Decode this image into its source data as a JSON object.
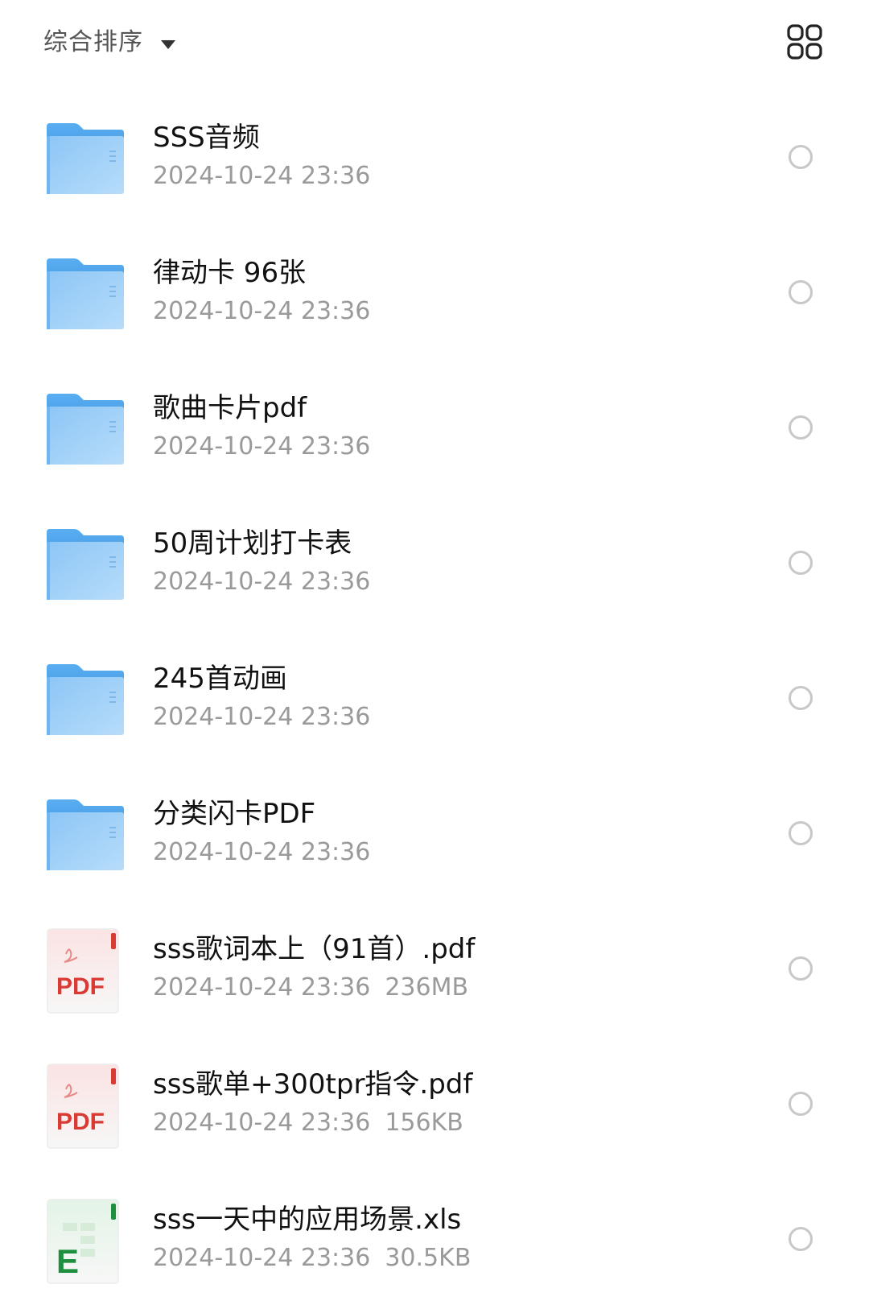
{
  "header": {
    "sort_label": "综合排序",
    "sort_icon": "caret-down-icon",
    "view_toggle_icon": "grid-view-icon"
  },
  "colors": {
    "folder_light": "#a9d4f7",
    "folder_dark": "#5aaef2",
    "pdf_red": "#d93a34",
    "xls_green": "#1e8f3f",
    "meta_gray": "#9a9a9a",
    "radio_gray": "#c8c8c8"
  },
  "files": [
    {
      "name": "SSS音频",
      "date": "2024-10-24 23:36",
      "size": "",
      "type": "folder",
      "icon": "folder-icon"
    },
    {
      "name": "律动卡 96张",
      "date": "2024-10-24 23:36",
      "size": "",
      "type": "folder",
      "icon": "folder-icon"
    },
    {
      "name": "歌曲卡片pdf",
      "date": "2024-10-24 23:36",
      "size": "",
      "type": "folder",
      "icon": "folder-icon"
    },
    {
      "name": "50周计划打卡表",
      "date": "2024-10-24 23:36",
      "size": "",
      "type": "folder",
      "icon": "folder-icon"
    },
    {
      "name": "245首动画",
      "date": "2024-10-24 23:36",
      "size": "",
      "type": "folder",
      "icon": "folder-icon"
    },
    {
      "name": "分类闪卡PDF",
      "date": "2024-10-24 23:36",
      "size": "",
      "type": "folder",
      "icon": "folder-icon"
    },
    {
      "name": "sss歌词本上（91首）.pdf",
      "date": "2024-10-24 23:36",
      "size": "236MB",
      "type": "pdf",
      "icon": "pdf-file-icon",
      "badge": "PDF"
    },
    {
      "name": "sss歌单+300tpr指令.pdf",
      "date": "2024-10-24 23:36",
      "size": "156KB",
      "type": "pdf",
      "icon": "pdf-file-icon",
      "badge": "PDF"
    },
    {
      "name": "sss一天中的应用场景.xls",
      "date": "2024-10-24 23:36",
      "size": "30.5KB",
      "type": "xls",
      "icon": "excel-file-icon",
      "badge": "E"
    }
  ]
}
